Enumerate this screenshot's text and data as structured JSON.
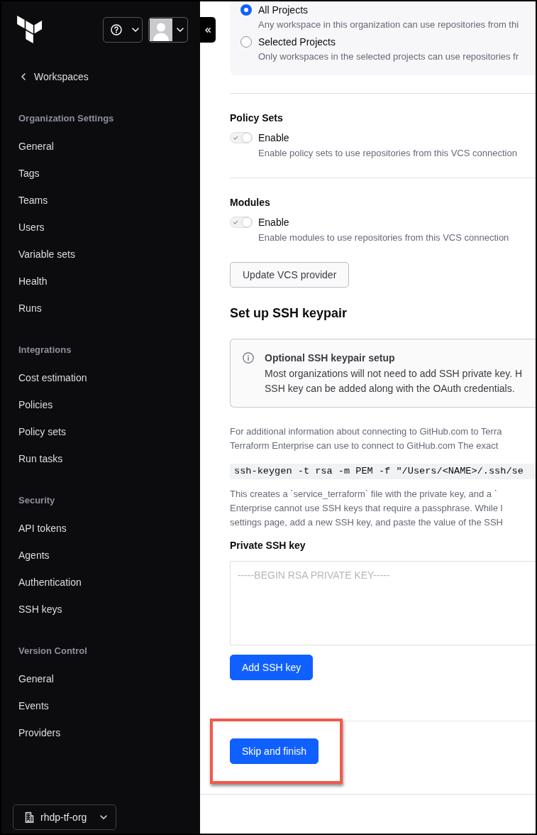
{
  "sidebar": {
    "back_link": "Workspaces",
    "sections": [
      {
        "heading": "Organization Settings",
        "items": [
          {
            "label": "General",
            "selected": false
          },
          {
            "label": "Tags",
            "selected": false
          },
          {
            "label": "Teams",
            "selected": false
          },
          {
            "label": "Users",
            "selected": false
          },
          {
            "label": "Variable sets",
            "selected": false
          },
          {
            "label": "Health",
            "selected": false
          },
          {
            "label": "Runs",
            "selected": false
          }
        ]
      },
      {
        "heading": "Integrations",
        "items": [
          {
            "label": "Cost estimation",
            "selected": false
          },
          {
            "label": "Policies",
            "selected": false
          },
          {
            "label": "Policy sets",
            "selected": false
          },
          {
            "label": "Run tasks",
            "selected": false
          }
        ]
      },
      {
        "heading": "Security",
        "items": [
          {
            "label": "API tokens",
            "selected": false
          },
          {
            "label": "Agents",
            "selected": false
          },
          {
            "label": "Authentication",
            "selected": false
          },
          {
            "label": "SSH keys",
            "selected": false
          }
        ]
      },
      {
        "heading": "Version Control",
        "items": [
          {
            "label": "General",
            "selected": false
          },
          {
            "label": "Events",
            "selected": false
          },
          {
            "label": "Providers",
            "selected": false
          }
        ]
      }
    ],
    "org_switcher": "rhdp-tf-org"
  },
  "main": {
    "project_scope": [
      {
        "label": "All Projects",
        "description": "Any workspace in this organization can use repositories from thi",
        "selected": true
      },
      {
        "label": "Selected Projects",
        "description": "Only workspaces in the selected projects can use repositories fr",
        "selected": false
      }
    ],
    "features": [
      {
        "title": "Policy Sets",
        "toggle": {
          "label": "Enable",
          "on": true,
          "disabled": true
        },
        "description": "Enable policy sets to use repositories from this VCS connection"
      },
      {
        "title": "Modules",
        "toggle": {
          "label": "Enable",
          "on": true,
          "disabled": true
        },
        "description": "Enable modules to use repositories from this VCS connection"
      }
    ],
    "update_button": "Update VCS provider",
    "ssh_setup": {
      "title": "Set up SSH keypair",
      "notice": {
        "title": "Optional SSH keypair setup",
        "lines": [
          "Most organizations will not need to add SSH private key. H",
          "SSH key can be added along with the OAuth credentials."
        ]
      },
      "intro_lines": [
        "For additional information about connecting to GitHub.com to Terra",
        "Terraform Enterprise can use to connect to GitHub.com The exact"
      ],
      "command": "ssh-keygen -t rsa -m PEM -f \"/Users/<NAME>/.ssh/se",
      "details_lines": [
        "This creates a `service_terraform` file with the private key, and a `",
        "Enterprise cannot use SSH keys that require a passphrase. While l",
        "settings page, add a new SSH key, and paste the value of the SSH"
      ],
      "key_field": {
        "label": "Private SSH key",
        "placeholder": "-----BEGIN RSA PRIVATE KEY-----"
      },
      "add_button": "Add SSH key"
    },
    "footer": {
      "skip_button": {
        "label": "Skip and finish",
        "highlighted": true
      }
    }
  }
}
